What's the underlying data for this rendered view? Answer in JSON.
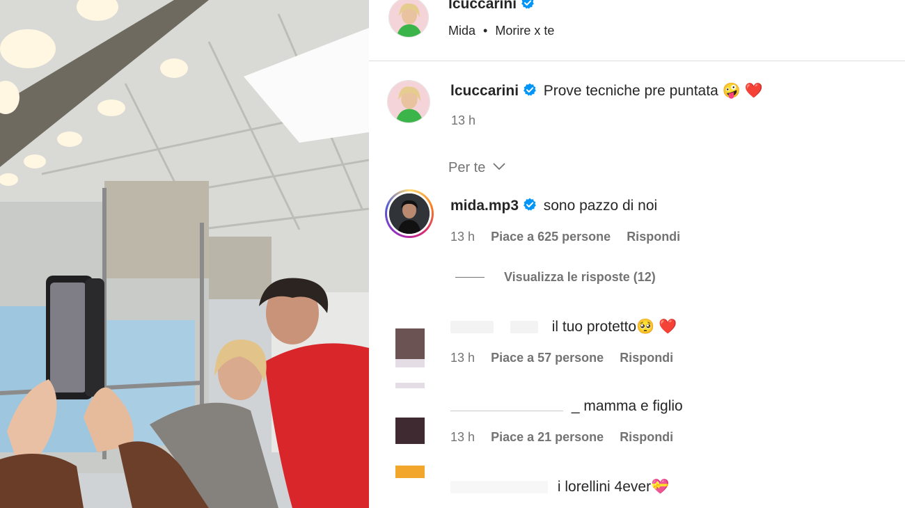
{
  "post": {
    "username": "lcuccarini",
    "audio_artist": "Mida",
    "audio_separator": "•",
    "audio_title": "Morire x te",
    "caption": "Prove tecniche pre puntata 🤪 ❤️",
    "caption_time": "13 h"
  },
  "section_filter": "Per te",
  "comments": [
    {
      "username": "mida.mp3",
      "text": "sono pazzo di noi",
      "time": "13 h",
      "likes": "Piace a 625 persone",
      "reply": "Rispondi",
      "view_replies": "Visualizza le risposte (12)"
    },
    {
      "username": "",
      "text": "il tuo protetto🥺 ❤️",
      "time": "13 h",
      "likes": "Piace a 57 persone",
      "reply": "Rispondi"
    },
    {
      "username": "",
      "text": "_ mamma e figlio",
      "time": "13 h",
      "likes": "Piace a 21 persone",
      "reply": "Rispondi"
    },
    {
      "username": "",
      "text": "i lorellini 4ever💝"
    }
  ],
  "colors": {
    "verified": "#0095f6",
    "secondary_text": "#737373",
    "divider": "#dbdbdb"
  },
  "icons": {
    "verified": "verified-badge-icon",
    "chevron": "chevron-down-icon"
  }
}
